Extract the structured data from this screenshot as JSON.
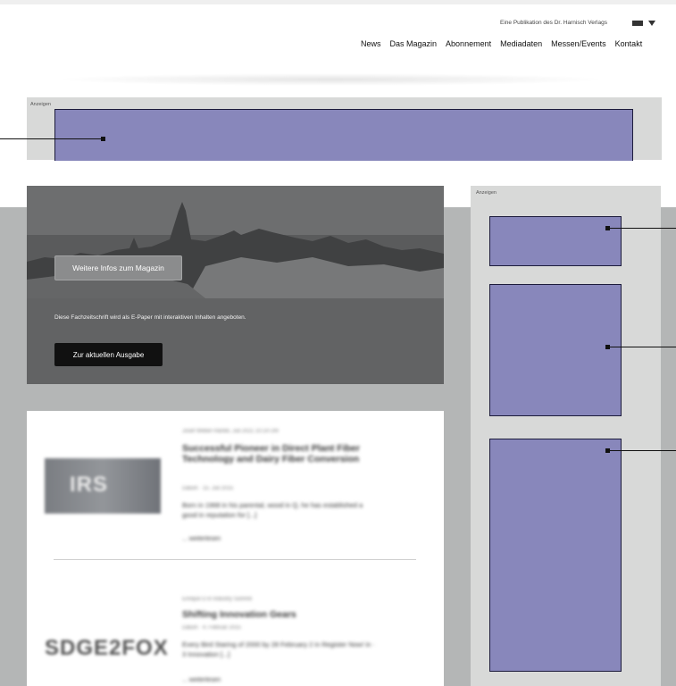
{
  "header": {
    "publication_prefix": "Eine Publikation des",
    "publication_link": "Dr. Harnisch Verlags",
    "nav": [
      "News",
      "Das Magazin",
      "Abonnement",
      "Mediadaten",
      "Messen/Events",
      "Kontakt"
    ]
  },
  "ads": {
    "label": "Anzeigen",
    "color": "#8887bb"
  },
  "hero": {
    "info_button": "Weitere Infos zum Magazin",
    "description": "Diese Fachzeitschrift wird als E-Paper mit interaktiven Inhalten angeboten.",
    "issue_button": "Zur aktuellen Ausgabe"
  },
  "articles": [
    {
      "meta": "Josef Weber-Hantel, Juli 2021 10:14 Uhr",
      "title": "Successful Pioneer in Direct Plant Fiber Technology and Dairy Fiber Conversion",
      "sub": "Datum · 15. Juli 2015",
      "teaser": "Born in 1968 in his parental, wood in Q, he has established a good in reputation for [...]",
      "more": "... weiterlesen",
      "thumb_text": "IRS"
    },
    {
      "meta": "Enrique D in Industry Summit",
      "title": "Shifting Innovation Gears",
      "sub": "Datum · 4. Februar 2015",
      "teaser": "Every Bird Staring of 2000 by 28 February 2 in Register Now! in · 3 Innovation [...]",
      "more": "... weiterlesen",
      "thumb_text": "SDGE2FOX"
    }
  ]
}
